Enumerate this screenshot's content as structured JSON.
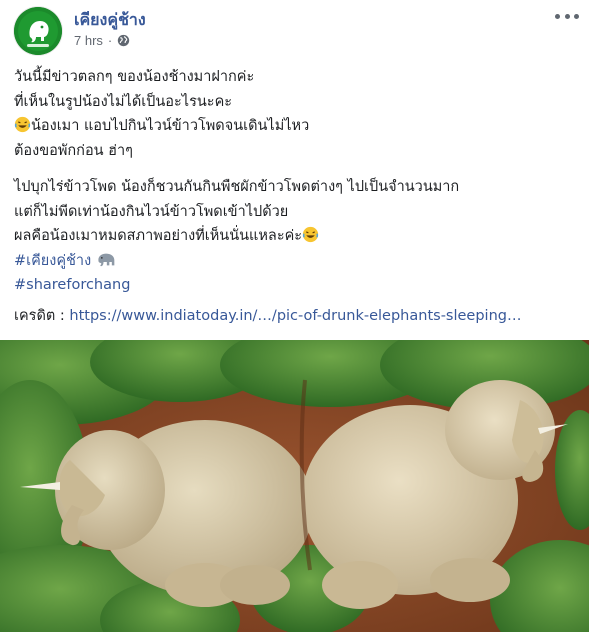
{
  "post": {
    "page_name": "เคียงคู่ช้าง",
    "timestamp": "7 hrs",
    "separator": "·",
    "lines": [
      "วันนี้มีข่าวตลกๆ ของน้องช้างมาฝากค่ะ",
      "ที่เห็นในรูปน้องไม่ได้เป็นอะไรนะคะ",
      "น้องเมา แอบไปกินไวน์ข้าวโพดจนเดินไม่ไหว",
      "ต้องขอพักก่อน ฮ่าๆ",
      "ไปบุกไร่ข้าวโพด น้องก็ชวนกันกินพืชผักข้าวโพดต่างๆ ไปเป็นจำนวนมาก",
      "แต่ก็ไม่พีดเท่าน้องกินไวน์ข้าวโพดเข้าไปด้วย",
      "ผลคือน้องเมาหมดสภาพอย่างที่เห็นนั่นแหละค่ะ"
    ],
    "hashtags": [
      "#เคียงคู่ช้าง",
      "#shareforchang"
    ],
    "credit_label": "เครดิต :",
    "credit_url": "https://www.indiatoday.in/…/pic-of-drunk-elephants-sleeping…"
  },
  "icons": {
    "avatar": "elephant-logo",
    "privacy": "globe-icon",
    "more": "more-options-icon",
    "laugh": "laughing-emoji",
    "elephant": "elephant-emoji"
  },
  "colors": {
    "link": "#385898",
    "text": "#1c1e21",
    "meta": "#616770",
    "brand_green": "#1b8a2b"
  }
}
